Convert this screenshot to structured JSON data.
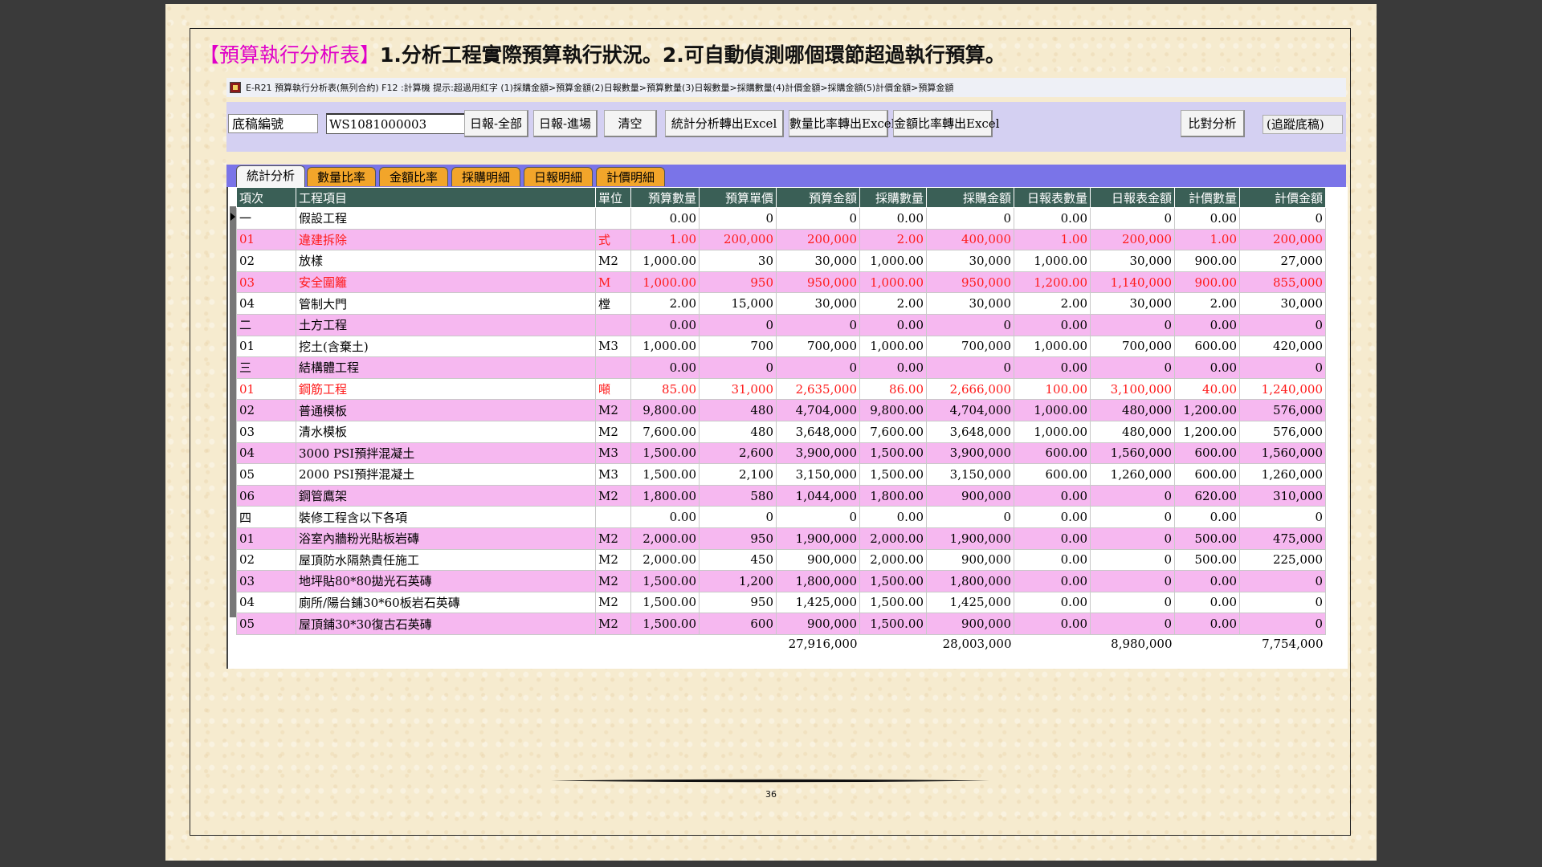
{
  "heading": {
    "tag": "【預算執行分析表】",
    "desc": "1.分析工程實際預算執行狀況。2.可自動偵測哪個環節超過執行預算。"
  },
  "window": {
    "title": "E-R21 預算執行分析表(無列合約)    F12 :計算機   提示:超過用紅字 (1)採購金額>預算金額(2)日報數量>預算數量(3)日報數量>採購數量(4)計價金額>採購金額(5)計價金額>預算金額"
  },
  "toolbar": {
    "draft_label": "底稿編號",
    "draft_value": "WS1081000003",
    "buttons": [
      "日報-全部",
      "日報-進場",
      "清空",
      "統計分析轉出Excel",
      "數量比率轉出Excel",
      "金額比率轉出Excel",
      "比對分析"
    ],
    "trace_label": "(追蹤底稿)"
  },
  "tabs": [
    "統計分析",
    "數量比率",
    "金額比率",
    "採購明細",
    "日報明細",
    "計價明細"
  ],
  "table": {
    "headers": [
      "項次",
      "工程項目",
      "單位",
      "預算數量",
      "預算單價",
      "預算金額",
      "採購數量",
      "採購金額",
      "日報表數量",
      "日報表金額",
      "計價數量",
      "計價金額"
    ],
    "rows": [
      {
        "c": [
          "一",
          "假設工程",
          "",
          "0.00",
          "0",
          "0",
          "0.00",
          "0",
          "0.00",
          "0",
          "0.00",
          "0"
        ],
        "over": false
      },
      {
        "c": [
          "01",
          "違建拆除",
          "式",
          "1.00",
          "200,000",
          "200,000",
          "2.00",
          "400,000",
          "1.00",
          "200,000",
          "1.00",
          "200,000"
        ],
        "over": true
      },
      {
        "c": [
          "02",
          "放樣",
          "M2",
          "1,000.00",
          "30",
          "30,000",
          "1,000.00",
          "30,000",
          "1,000.00",
          "30,000",
          "900.00",
          "27,000"
        ],
        "over": false
      },
      {
        "c": [
          "03",
          "安全圍籬",
          "M",
          "1,000.00",
          "950",
          "950,000",
          "1,000.00",
          "950,000",
          "1,200.00",
          "1,140,000",
          "900.00",
          "855,000"
        ],
        "over": true
      },
      {
        "c": [
          "04",
          "管制大門",
          "樘",
          "2.00",
          "15,000",
          "30,000",
          "2.00",
          "30,000",
          "2.00",
          "30,000",
          "2.00",
          "30,000"
        ],
        "over": false
      },
      {
        "c": [
          "二",
          "土方工程",
          "",
          "0.00",
          "0",
          "0",
          "0.00",
          "0",
          "0.00",
          "0",
          "0.00",
          "0"
        ],
        "over": false
      },
      {
        "c": [
          "01",
          "挖土(含棄土)",
          "M3",
          "1,000.00",
          "700",
          "700,000",
          "1,000.00",
          "700,000",
          "1,000.00",
          "700,000",
          "600.00",
          "420,000"
        ],
        "over": false
      },
      {
        "c": [
          "三",
          "結構體工程",
          "",
          "0.00",
          "0",
          "0",
          "0.00",
          "0",
          "0.00",
          "0",
          "0.00",
          "0"
        ],
        "over": false
      },
      {
        "c": [
          "01",
          "鋼筋工程",
          "噸",
          "85.00",
          "31,000",
          "2,635,000",
          "86.00",
          "2,666,000",
          "100.00",
          "3,100,000",
          "40.00",
          "1,240,000"
        ],
        "over": true
      },
      {
        "c": [
          "02",
          "普通模板",
          "M2",
          "9,800.00",
          "480",
          "4,704,000",
          "9,800.00",
          "4,704,000",
          "1,000.00",
          "480,000",
          "1,200.00",
          "576,000"
        ],
        "over": false
      },
      {
        "c": [
          "03",
          "清水模板",
          "M2",
          "7,600.00",
          "480",
          "3,648,000",
          "7,600.00",
          "3,648,000",
          "1,000.00",
          "480,000",
          "1,200.00",
          "576,000"
        ],
        "over": false
      },
      {
        "c": [
          "04",
          "3000 PSI預拌混凝土",
          "M3",
          "1,500.00",
          "2,600",
          "3,900,000",
          "1,500.00",
          "3,900,000",
          "600.00",
          "1,560,000",
          "600.00",
          "1,560,000"
        ],
        "over": false
      },
      {
        "c": [
          "05",
          "2000 PSI預拌混凝土",
          "M3",
          "1,500.00",
          "2,100",
          "3,150,000",
          "1,500.00",
          "3,150,000",
          "600.00",
          "1,260,000",
          "600.00",
          "1,260,000"
        ],
        "over": false
      },
      {
        "c": [
          "06",
          "鋼管鷹架",
          "M2",
          "1,800.00",
          "580",
          "1,044,000",
          "1,800.00",
          "900,000",
          "0.00",
          "0",
          "620.00",
          "310,000"
        ],
        "over": false
      },
      {
        "c": [
          "四",
          "裝修工程含以下各項",
          "",
          "0.00",
          "0",
          "0",
          "0.00",
          "0",
          "0.00",
          "0",
          "0.00",
          "0"
        ],
        "over": false
      },
      {
        "c": [
          "01",
          "浴室內牆粉光貼板岩磚",
          "M2",
          "2,000.00",
          "950",
          "1,900,000",
          "2,000.00",
          "1,900,000",
          "0.00",
          "0",
          "500.00",
          "475,000"
        ],
        "over": false
      },
      {
        "c": [
          "02",
          "屋頂防水隔熱責任施工",
          "M2",
          "2,000.00",
          "450",
          "900,000",
          "2,000.00",
          "900,000",
          "0.00",
          "0",
          "500.00",
          "225,000"
        ],
        "over": false
      },
      {
        "c": [
          "03",
          "地坪貼80*80拋光石英磚",
          "M2",
          "1,500.00",
          "1,200",
          "1,800,000",
          "1,500.00",
          "1,800,000",
          "0.00",
          "0",
          "0.00",
          "0"
        ],
        "over": false
      },
      {
        "c": [
          "04",
          "廁所/陽台鋪30*60板岩石英磚",
          "M2",
          "1,500.00",
          "950",
          "1,425,000",
          "1,500.00",
          "1,425,000",
          "0.00",
          "0",
          "0.00",
          "0"
        ],
        "over": false
      },
      {
        "c": [
          "05",
          "屋頂鋪30*30復古石英磚",
          "M2",
          "1,500.00",
          "600",
          "900,000",
          "1,500.00",
          "900,000",
          "0.00",
          "0",
          "0.00",
          "0"
        ],
        "over": false
      }
    ],
    "totals": [
      "",
      "",
      "",
      "",
      "",
      "27,916,000",
      "",
      "28,003,000",
      "",
      "8,980,000",
      "",
      "7,754,000"
    ]
  },
  "page_number": "36",
  "colors": {
    "heading_tag": "#e000c8",
    "row_pink": "#f6b8f0",
    "over_budget": "#ff1a1a",
    "header_bg": "#3a5f56",
    "tab_bg": "#f2a52a",
    "tabstrip_bg": "#7a74e8"
  }
}
